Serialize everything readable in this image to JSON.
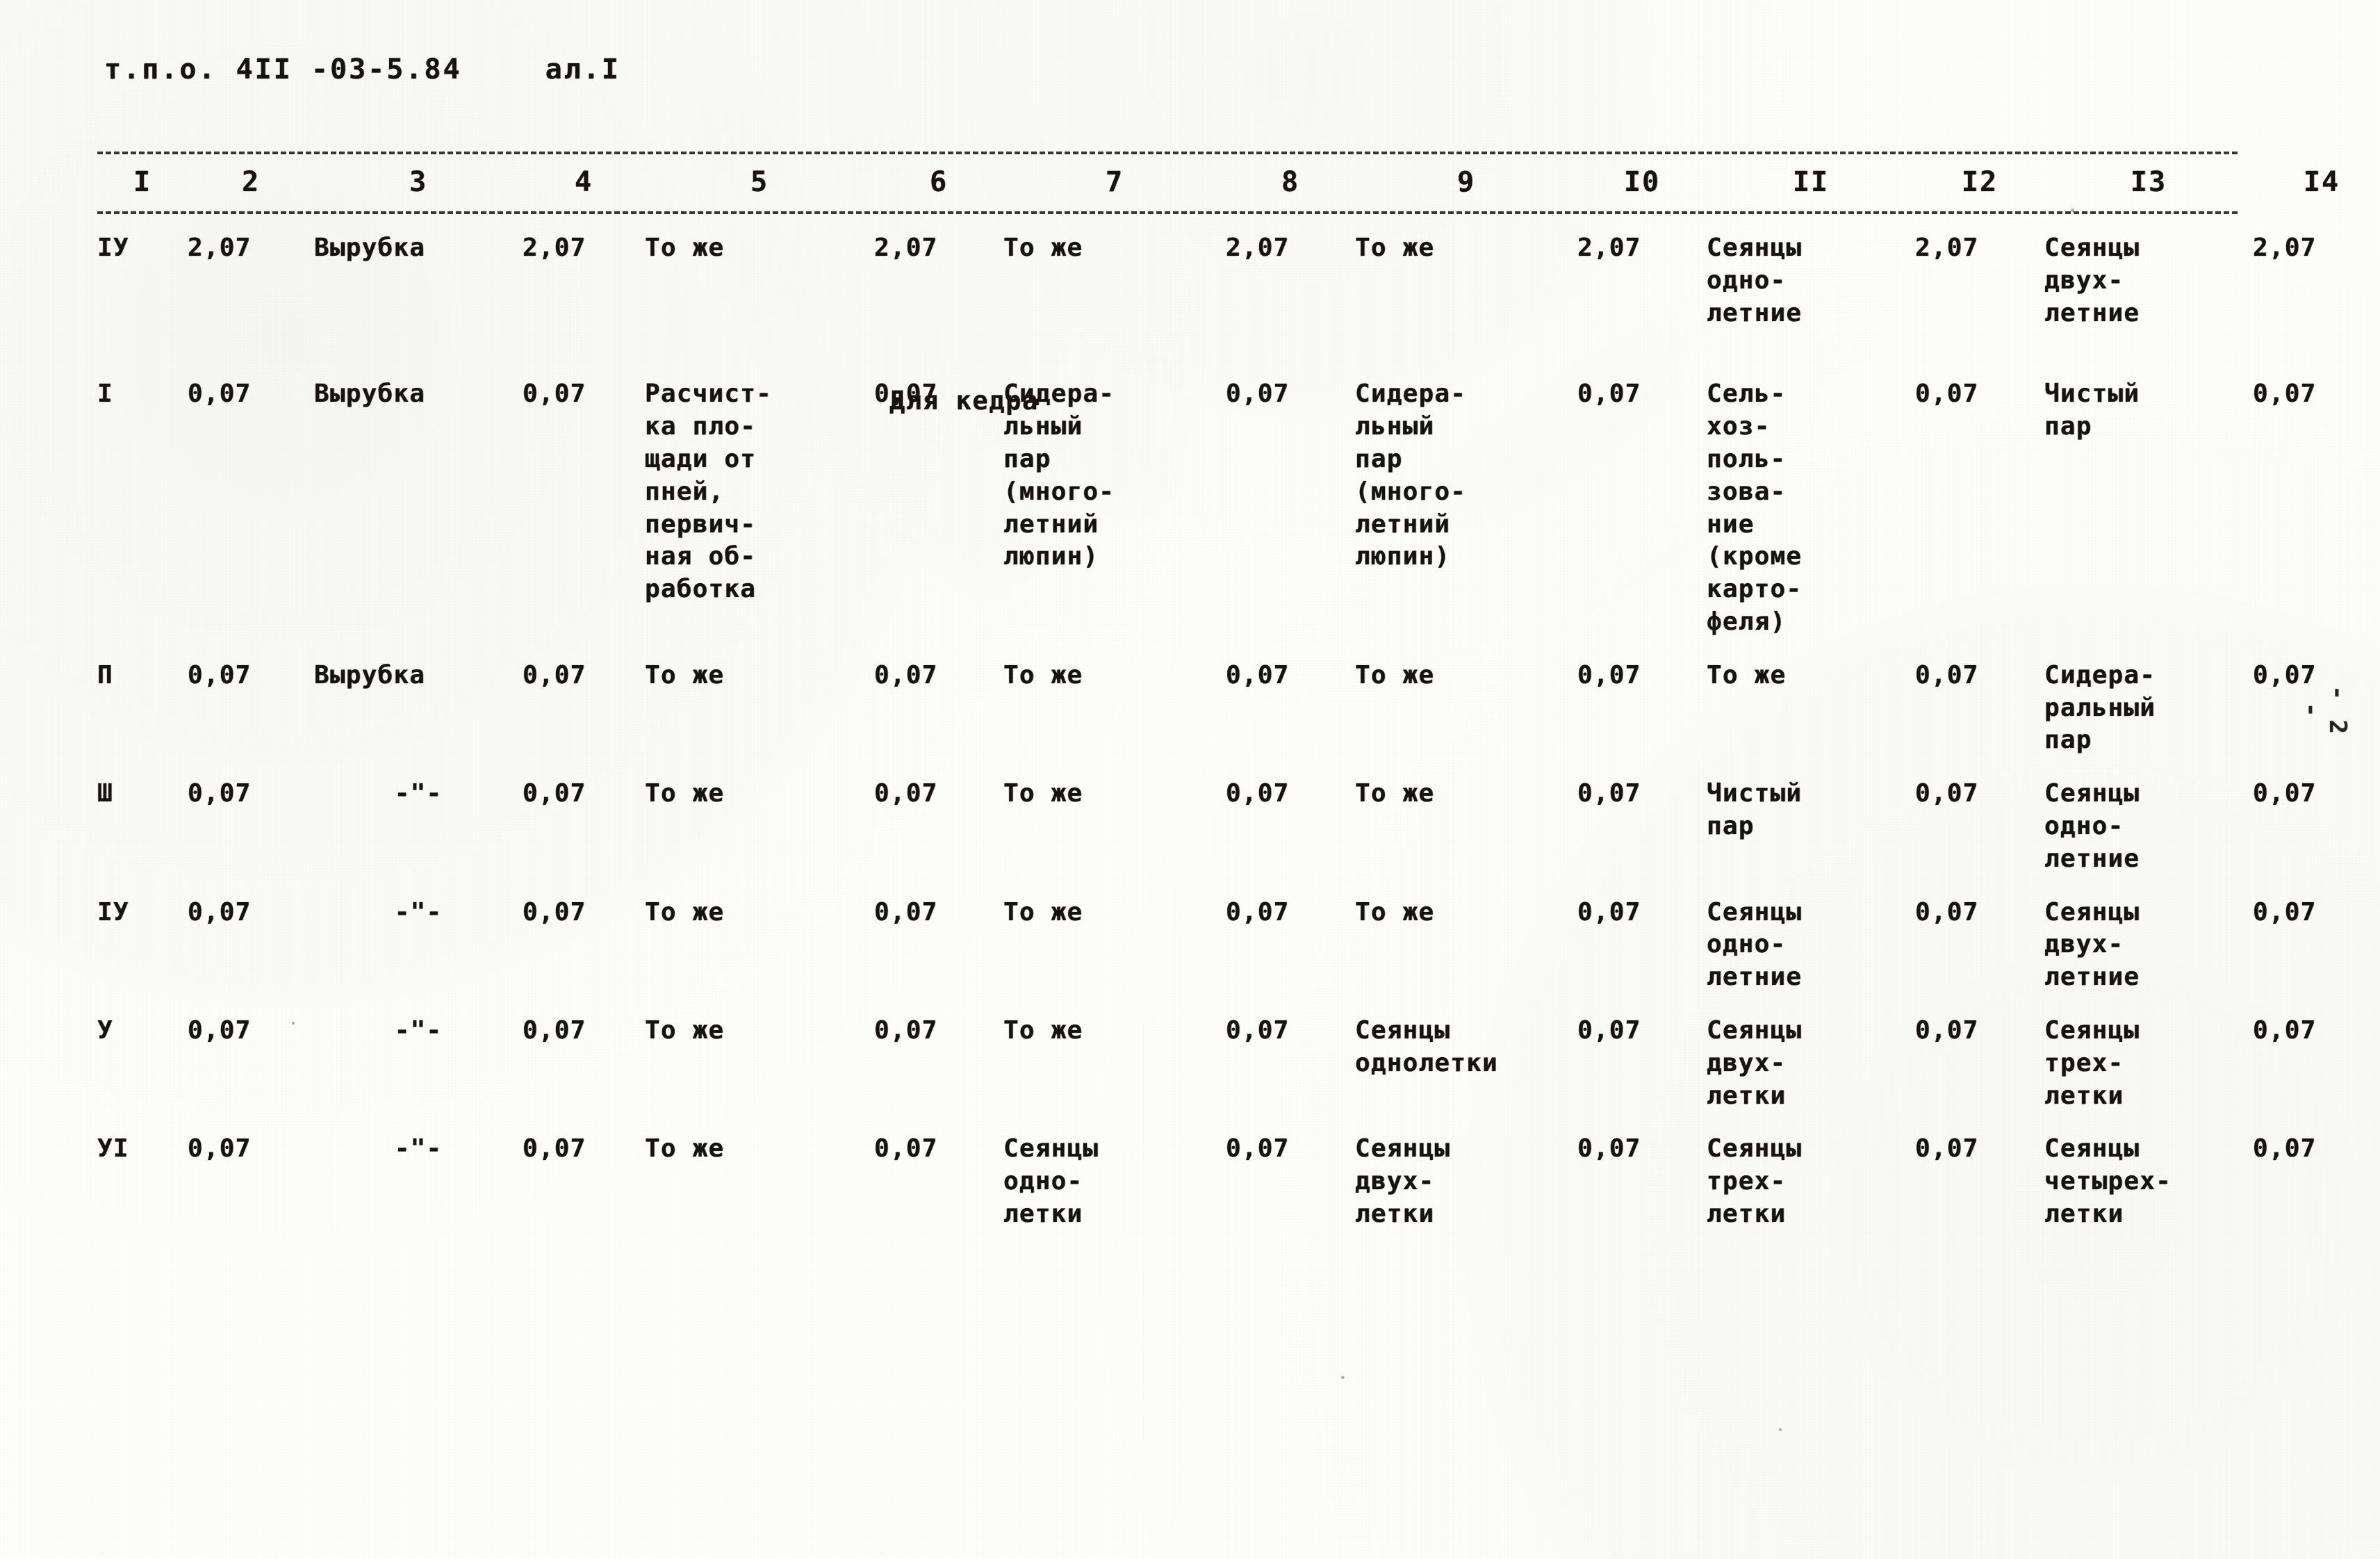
{
  "document": {
    "header_code": "т.п.о. 4II -03-5.84",
    "header_sheet": "ал.I",
    "page_marker": "- 2 -",
    "section_caption": "Для кедра"
  },
  "table": {
    "column_numbers": [
      "I",
      "2",
      "3",
      "4",
      "5",
      "6",
      "7",
      "8",
      "9",
      "I0",
      "II",
      "I2",
      "I3",
      "I4"
    ],
    "rows": [
      {
        "id": "row-iv-top",
        "c1": "IУ",
        "c2": "2,07",
        "c3": "Вырубка",
        "c4": "2,07",
        "c5": "То же",
        "c6": "2,07",
        "c7": "То же",
        "c8": "2,07",
        "c9": "То же",
        "c10": "2,07",
        "c11": "Сеянцы\nодно-\nлетние",
        "c12": "2,07",
        "c13": "Сеянцы\nдвух-\nлетние",
        "c14": "2,07"
      },
      {
        "id": "row-i",
        "c1": "I",
        "c2": "0,07",
        "c3": "Вырубка",
        "c4": "0,07",
        "c5": "Расчист-\nка пло-\nщади от\nпней,\nпервич-\nная об-\nработка",
        "c6": "0,07",
        "c7": "Сидера-\nльный\nпар\n(много-\nлетний\nлюпин)",
        "c8": "0,07",
        "c9": "Сидера-\nльный\nпар\n(много-\nлетний\nлюпин)",
        "c10": "0,07",
        "c11": "Сель-\nхоз-\nполь-\nзова-\nние\n(кроме\nкарто-\nфеля)",
        "c12": "0,07",
        "c13": "Чистый\nпар",
        "c14": "0,07"
      },
      {
        "id": "row-ii",
        "c1": "П",
        "c2": "0,07",
        "c3": "Вырубка",
        "c4": "0,07",
        "c5": "То же",
        "c6": "0,07",
        "c7": "То же",
        "c8": "0,07",
        "c9": "То же",
        "c10": "0,07",
        "c11": "То же",
        "c12": "0,07",
        "c13": "Сидера-\nральный\nпар",
        "c14": "0,07"
      },
      {
        "id": "row-iii",
        "c1": "Ш",
        "c2": "0,07",
        "c3": "-\"-",
        "c4": "0,07",
        "c5": "То же",
        "c6": "0,07",
        "c7": "То же",
        "c8": "0,07",
        "c9": "То же",
        "c10": "0,07",
        "c11": "Чистый\nпар",
        "c12": "0,07",
        "c13": "Сеянцы\nодно-\nлетние",
        "c14": "0,07"
      },
      {
        "id": "row-iv",
        "c1": "IУ",
        "c2": "0,07",
        "c3": "-\"-",
        "c4": "0,07",
        "c5": "То же",
        "c6": "0,07",
        "c7": "То же",
        "c8": "0,07",
        "c9": "То же",
        "c10": "0,07",
        "c11": "Сеянцы\nодно-\nлетние",
        "c12": "0,07",
        "c13": "Сеянцы\nдвух-\nлетние",
        "c14": "0,07"
      },
      {
        "id": "row-v",
        "c1": "У",
        "c2": "0,07",
        "c3": "-\"-",
        "c4": "0,07",
        "c5": "То же",
        "c6": "0,07",
        "c7": "То же",
        "c8": "0,07",
        "c9": "Сеянцы\nоднолетки",
        "c10": "0,07",
        "c11": "Сеянцы\nдвух-\nлетки",
        "c12": "0,07",
        "c13": "Сеянцы\nтрех-\nлетки",
        "c14": "0,07"
      },
      {
        "id": "row-vi",
        "c1": "УI",
        "c2": "0,07",
        "c3": "-\"-",
        "c4": "0,07",
        "c5": "То же",
        "c6": "0,07",
        "c7": "Сеянцы\nодно-\nлетки",
        "c8": "0,07",
        "c9": "Сеянцы\nдвух-\nлетки",
        "c10": "0,07",
        "c11": "Сеянцы\nтрех-\nлетки",
        "c12": "0,07",
        "c13": "Сеянцы\nчетырех-\nлетки",
        "c14": "0,07"
      }
    ]
  }
}
